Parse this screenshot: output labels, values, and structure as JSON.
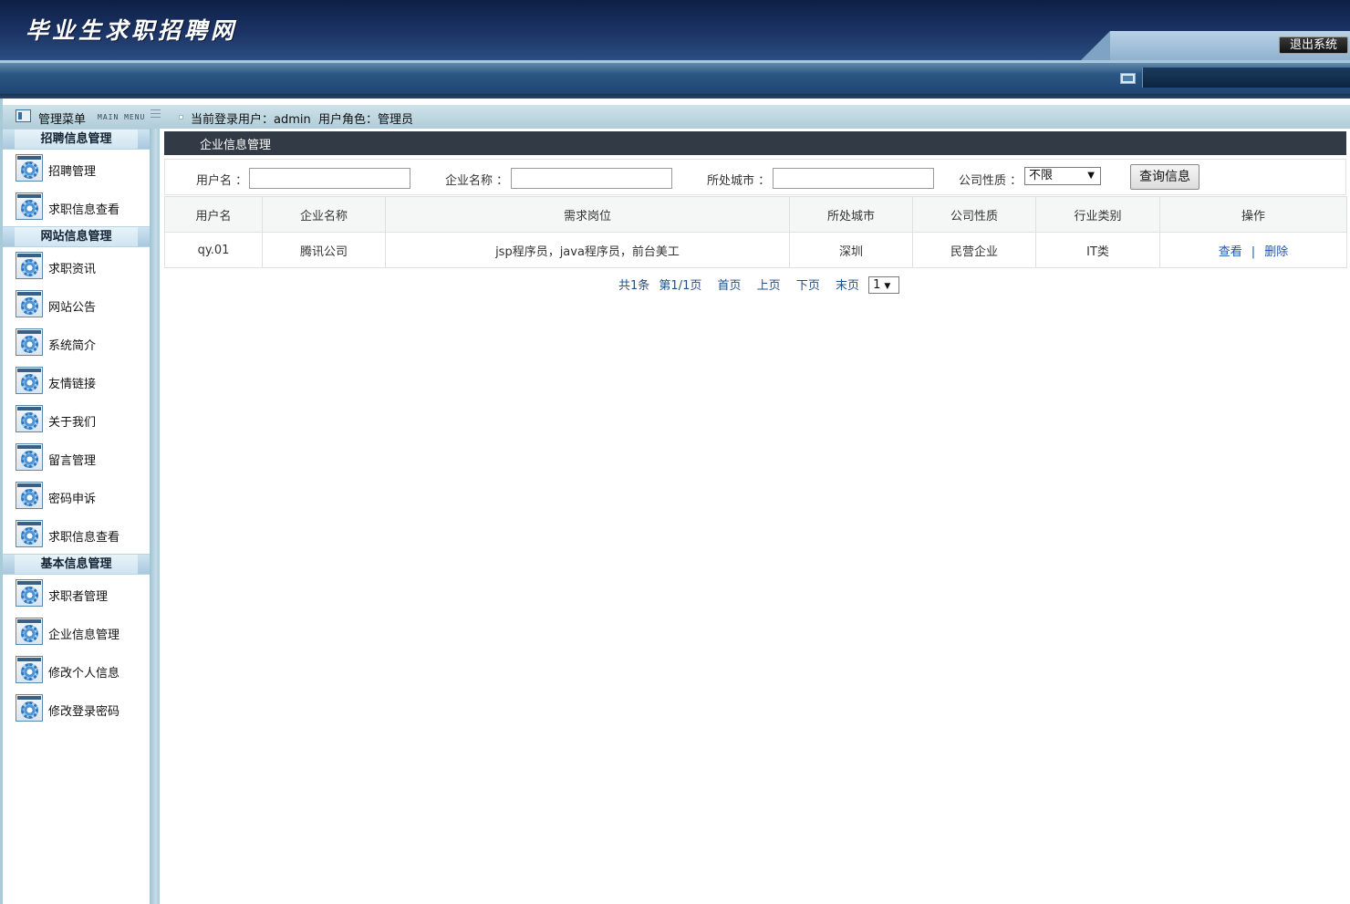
{
  "header": {
    "logo_text": "毕业生求职招聘网",
    "logout_label": "退出系统"
  },
  "infobar": {
    "menu_title": "管理菜单",
    "menu_title_en": "MAIN MENU",
    "user_label": "当前登录用户：",
    "user_value": "admin",
    "role_label": "用户角色：",
    "role_value": "管理员"
  },
  "sidebar": {
    "groups": [
      {
        "title": "招聘信息管理",
        "items": [
          "招聘管理",
          "求职信息查看"
        ]
      },
      {
        "title": "网站信息管理",
        "items": [
          "求职资讯",
          "网站公告",
          "系统简介",
          "友情链接",
          "关于我们",
          "留言管理",
          "密码申诉",
          "求职信息查看"
        ]
      },
      {
        "title": "基本信息管理",
        "items": [
          "求职者管理",
          "企业信息管理",
          "修改个人信息",
          "修改登录密码"
        ]
      }
    ]
  },
  "main": {
    "panel_title": "企业信息管理",
    "search": {
      "username_label": "用户名 ：",
      "username_value": "",
      "company_label": "企业名称 ：",
      "company_value": "",
      "city_label": "所处城市 ：",
      "city_value": "",
      "nature_label": "公司性质 ：",
      "nature_value": "不限",
      "query_label": "查询信息"
    },
    "table": {
      "headers": [
        "用户名",
        "企业名称",
        "需求岗位",
        "所处城市",
        "公司性质",
        "行业类别",
        "操作"
      ],
      "rows": [
        {
          "username": "qy.01",
          "company": "腾讯公司",
          "positions": "jsp程序员，java程序员，前台美工",
          "city": "深圳",
          "nature": "民营企业",
          "industry": "IT类",
          "view": "查看",
          "separator": "|",
          "delete": "删除"
        }
      ]
    },
    "pager": {
      "total": "共1条",
      "page_info": "第1/1页",
      "first": "首页",
      "prev": "上页",
      "next": "下页",
      "last": "末页",
      "page_select": "1"
    }
  },
  "colors": {
    "header_dark": "#0d1f44",
    "panel_title_bg": "#323b45",
    "frame_bg": "#a9cbd8",
    "link": "#1a55b0"
  }
}
